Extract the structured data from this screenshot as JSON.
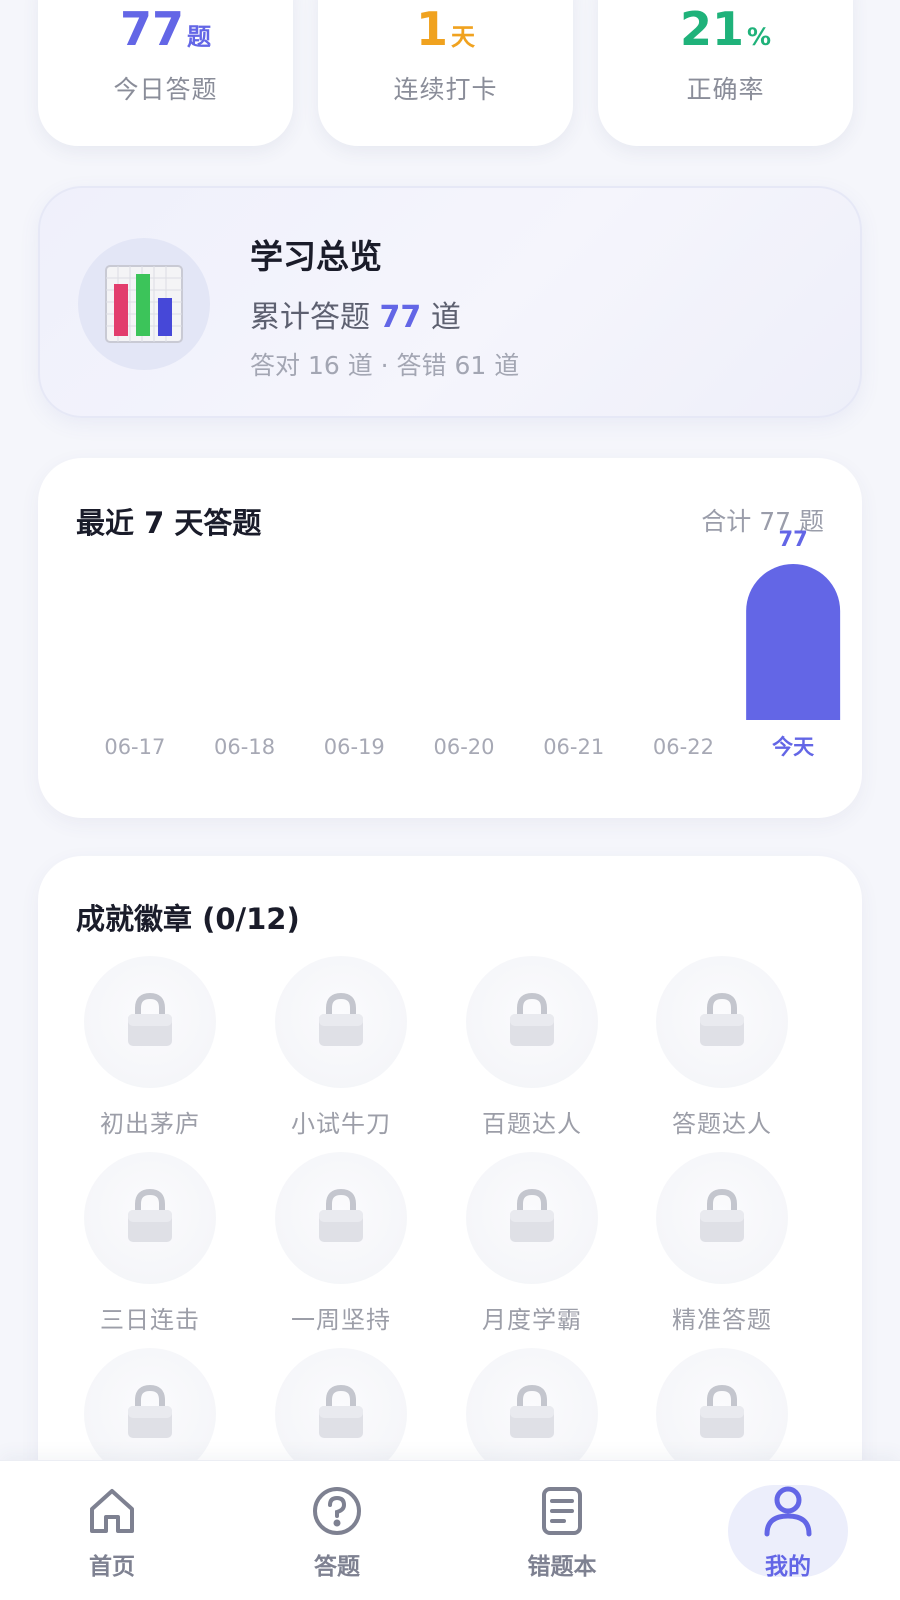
{
  "stats": [
    {
      "value": "77",
      "unit": "题",
      "label": "今日答题",
      "color": "#6366e6"
    },
    {
      "value": "1",
      "unit": "天",
      "label": "连续打卡",
      "color": "#f0a21f"
    },
    {
      "value": "21",
      "unit": "%",
      "label": "正确率",
      "color": "#1fb27a"
    }
  ],
  "overview": {
    "title": "学习总览",
    "total_prefix": "累计答题",
    "total_value": "77",
    "total_suffix": "道",
    "detail": "答对 16 道 · 答错 61 道"
  },
  "chart_data": {
    "type": "bar",
    "title": "最近 7 天答题",
    "total_label": "合计 77 题",
    "categories": [
      "06-17",
      "06-18",
      "06-19",
      "06-20",
      "06-21",
      "06-22",
      "今天"
    ],
    "values": [
      0,
      0,
      0,
      0,
      0,
      0,
      77
    ],
    "value_labels": [
      "",
      "",
      "",
      "",
      "",
      "",
      "77"
    ],
    "bar_color": "#6366e6",
    "highlight_index": 6,
    "ylim": [
      0,
      77
    ]
  },
  "badges": {
    "title": "成就徽章 (0/12)",
    "items": [
      "初出茅庐",
      "小试牛刀",
      "百题达人",
      "答题达人",
      "三日连击",
      "一周坚持",
      "月度学霸",
      "精准答题",
      "",
      "",
      "",
      ""
    ],
    "icon": "lock-icon"
  },
  "tabs": [
    {
      "label": "首页",
      "icon": "home-icon"
    },
    {
      "label": "答题",
      "icon": "question-icon"
    },
    {
      "label": "错题本",
      "icon": "notebook-icon"
    },
    {
      "label": "我的",
      "icon": "user-icon",
      "active": true
    }
  ],
  "accent": "#6366e6"
}
